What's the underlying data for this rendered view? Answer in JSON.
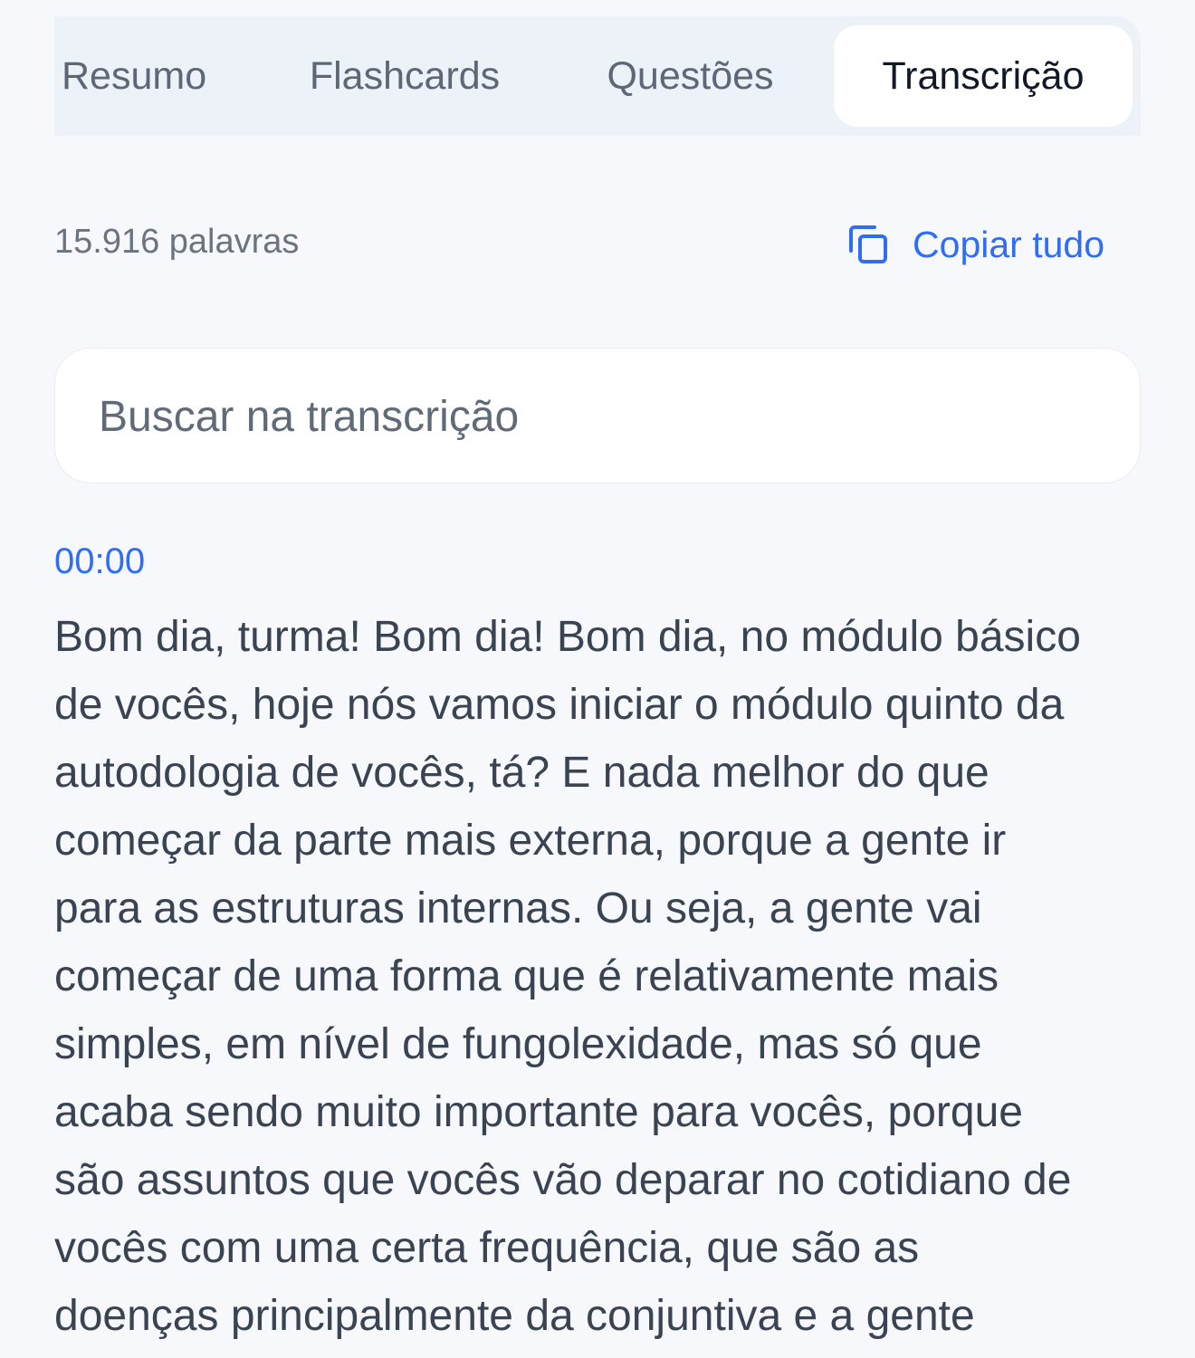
{
  "tabs": [
    {
      "label": "Resumo",
      "active": false
    },
    {
      "label": "Flashcards",
      "active": false
    },
    {
      "label": "Questões",
      "active": false
    },
    {
      "label": "Transcrição",
      "active": true
    }
  ],
  "meta": {
    "word_count": "15.916 palavras",
    "copy_label": "Copiar tudo",
    "copy_icon": "copy-icon"
  },
  "search": {
    "placeholder": "Buscar na transcrição",
    "value": ""
  },
  "transcript": {
    "timestamp": "00:00",
    "lines": [
      "Bom dia, turma! Bom dia! Bom dia, no módulo básico",
      "de vocês, hoje nós vamos iniciar o módulo quinto da",
      "autodologia de vocês, tá? E nada melhor do que",
      "começar da parte mais externa, porque a gente ir",
      "para as estruturas internas. Ou seja, a gente vai",
      "começar de uma forma que é relativamente mais",
      "simples, em nível de fungolexidade, mas só que",
      "acaba sendo muito importante para vocês, porque",
      "são assuntos que vocês vão deparar no cotidiano de",
      "vocês com uma certa frequência, que são as",
      "doenças principalmente da conjuntiva e a gente"
    ]
  },
  "colors": {
    "accent": "#2f6df6",
    "background": "#f6f8fc",
    "tab_bar": "#edf1f8",
    "active_tab": "#ffffff"
  }
}
